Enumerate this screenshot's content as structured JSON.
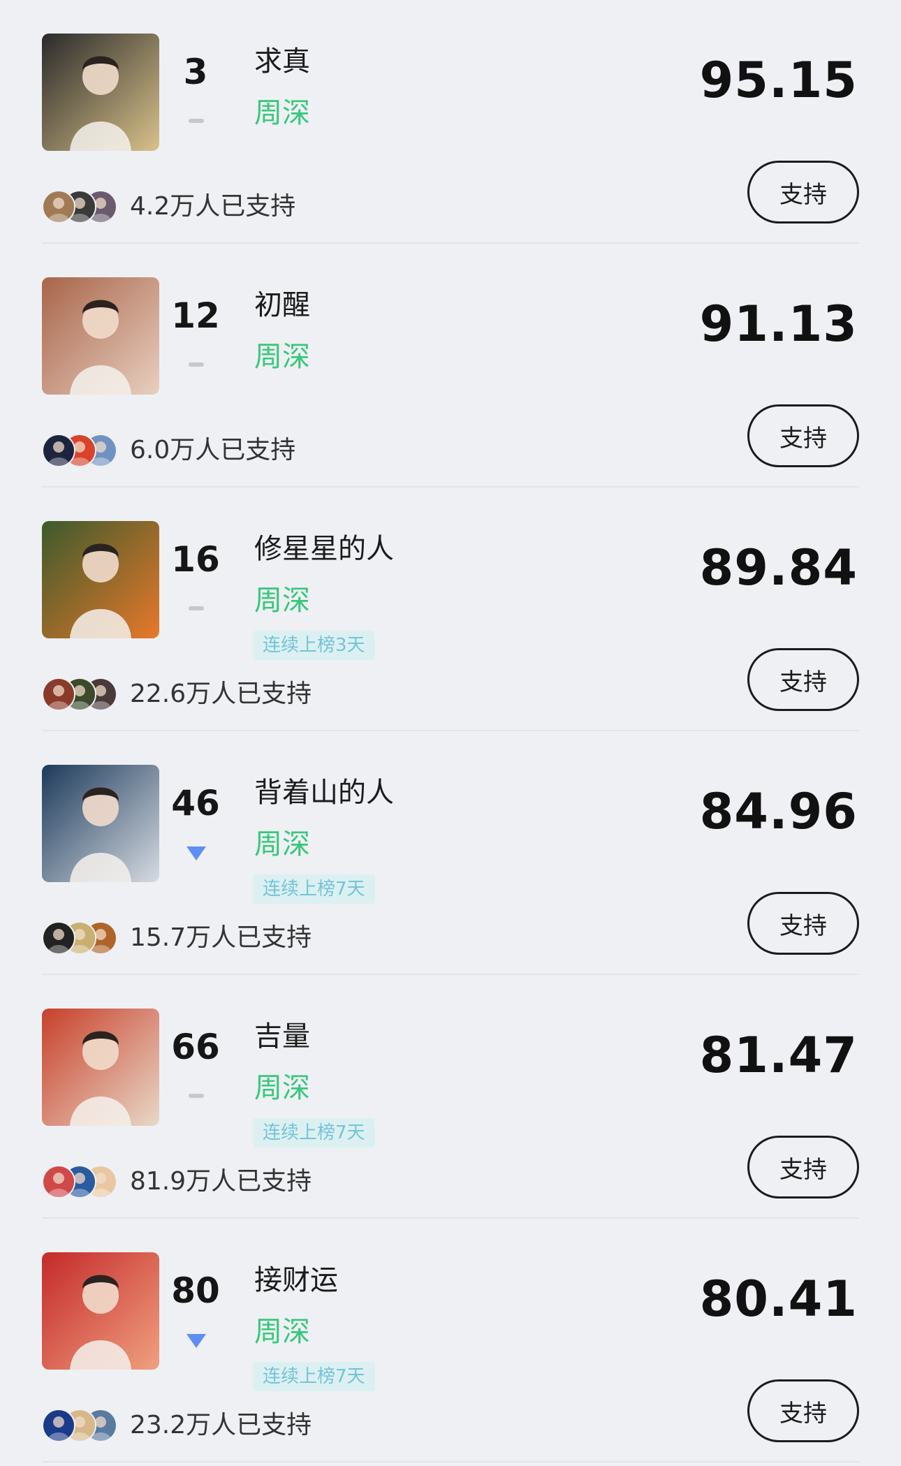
{
  "support_label": "支持",
  "colors": {
    "artist": "#36c87a",
    "streak_bg": "#dcf0f2",
    "streak_text": "#74c4d8",
    "down_arrow": "#5b8ff5"
  },
  "items": [
    {
      "rank": "3",
      "trend": "flat",
      "title": "求真",
      "artist": "周深",
      "streak": "",
      "score": "95.15",
      "supporters": "4.2万人已支持",
      "cover_colors": [
        "#2a2a2a",
        "#d9c28a"
      ],
      "avatar_colors": [
        "#a07a55",
        "#3a3a3a",
        "#6b5a6e"
      ]
    },
    {
      "rank": "12",
      "trend": "flat",
      "title": "初醒",
      "artist": "周深",
      "streak": "",
      "score": "91.13",
      "supporters": "6.0万人已支持",
      "cover_colors": [
        "#a8654a",
        "#e8cfc0"
      ],
      "avatar_colors": [
        "#1c2440",
        "#d8432a",
        "#6f93c0"
      ]
    },
    {
      "rank": "16",
      "trend": "flat",
      "title": "修星星的人",
      "artist": "周深",
      "streak": "连续上榜3天",
      "score": "89.84",
      "supporters": "22.6万人已支持",
      "cover_colors": [
        "#3c5a2c",
        "#e8782a"
      ],
      "avatar_colors": [
        "#8a3a2a",
        "#3a4a2a",
        "#4a3a3a"
      ]
    },
    {
      "rank": "46",
      "trend": "down",
      "title": "背着山的人",
      "artist": "周深",
      "streak": "连续上榜7天",
      "score": "84.96",
      "supporters": "15.7万人已支持",
      "cover_colors": [
        "#1d3a5a",
        "#d6dbe2"
      ],
      "avatar_colors": [
        "#222222",
        "#c9b070",
        "#b0642a"
      ]
    },
    {
      "rank": "66",
      "trend": "flat",
      "title": "吉量",
      "artist": "周深",
      "streak": "连续上榜7天",
      "score": "81.47",
      "supporters": "81.9万人已支持",
      "cover_colors": [
        "#c8402a",
        "#e8d8c8"
      ],
      "avatar_colors": [
        "#d04848",
        "#2a5aa0",
        "#e8c8a0"
      ]
    },
    {
      "rank": "80",
      "trend": "down",
      "title": "接财运",
      "artist": "周深",
      "streak": "连续上榜7天",
      "score": "80.41",
      "supporters": "23.2万人已支持",
      "cover_colors": [
        "#c42a2a",
        "#f0a080"
      ],
      "avatar_colors": [
        "#1a3a8a",
        "#d8b888",
        "#5a7aa0"
      ]
    }
  ]
}
